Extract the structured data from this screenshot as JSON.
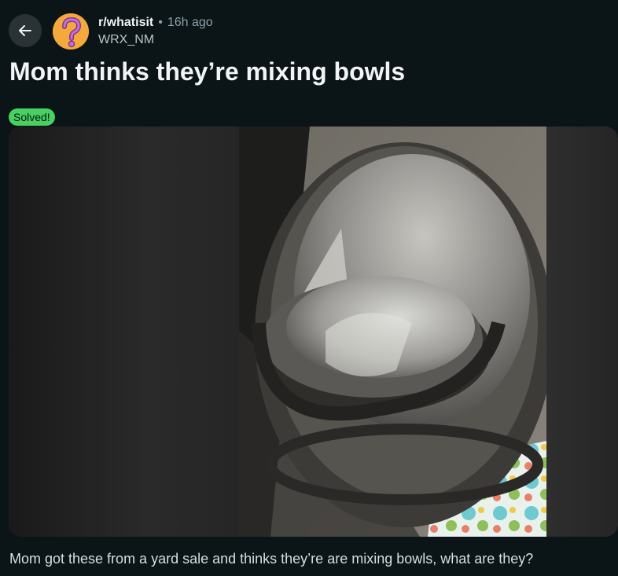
{
  "header": {
    "back_icon": "arrow-left-icon",
    "avatar_icon": "question-mark-icon",
    "subreddit": "r/whatisit",
    "separator": "•",
    "time": "16h ago",
    "author": "WRX_NM"
  },
  "post": {
    "title": "Mom thinks they’re mixing bowls",
    "flair": "Solved!",
    "flair_color": "#46d160",
    "body": "Mom got these from a yard sale and thinks they’re are mixing bowls, what are they?"
  },
  "colors": {
    "background": "#0b1416",
    "button_bg": "#2a3236",
    "muted_text": "#8ba2ad"
  }
}
